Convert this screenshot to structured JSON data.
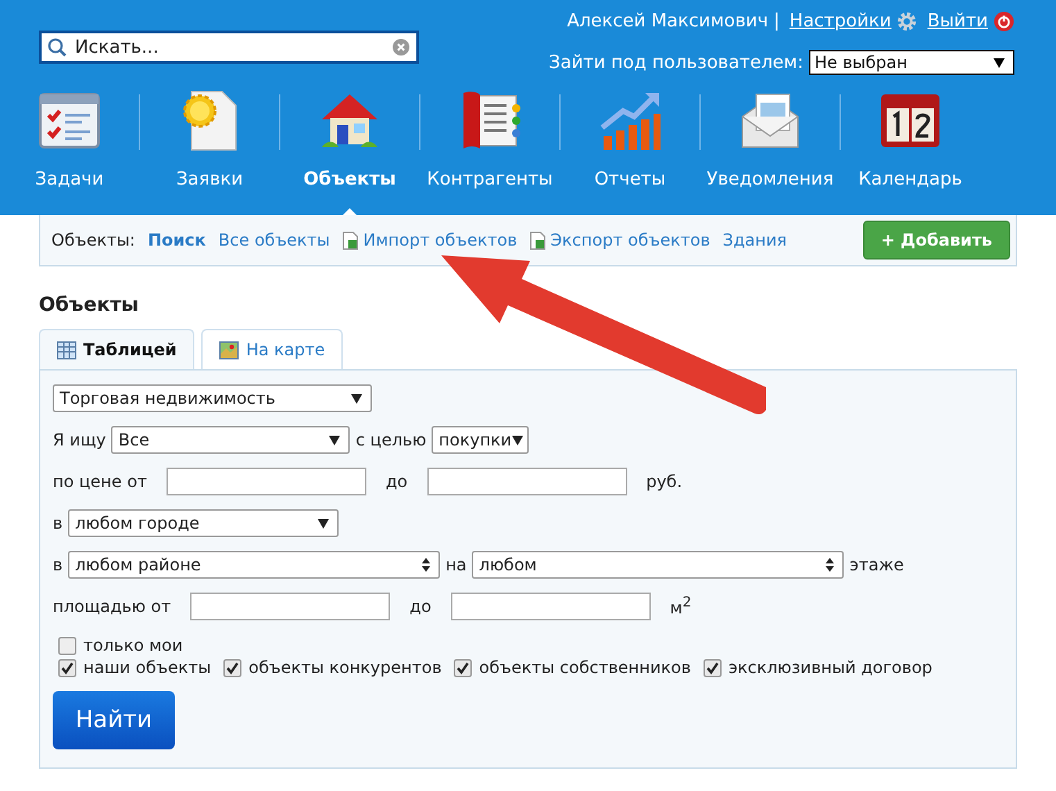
{
  "search": {
    "placeholder": "Искать..."
  },
  "user": {
    "name": "Алексей Максимович",
    "separator": "|",
    "settings": "Настройки",
    "logout": "Выйти"
  },
  "impersonate": {
    "label": "Зайти под пользователем:",
    "value": "Не выбран"
  },
  "nav": [
    {
      "label": "Задачи",
      "selected": false
    },
    {
      "label": "Заявки",
      "selected": false
    },
    {
      "label": "Объекты",
      "selected": true
    },
    {
      "label": "Контрагенты",
      "selected": false
    },
    {
      "label": "Отчеты",
      "selected": false
    },
    {
      "label": "Уведомления",
      "selected": false
    },
    {
      "label": "Календарь",
      "selected": false
    }
  ],
  "subnav": {
    "label": "Объекты:",
    "links": [
      {
        "label": "Поиск",
        "selected": true,
        "kind": "plain"
      },
      {
        "label": "Все объекты",
        "selected": false,
        "kind": "plain"
      },
      {
        "label": "Импорт объектов",
        "selected": false,
        "kind": "import"
      },
      {
        "label": "Экспорт объектов",
        "selected": false,
        "kind": "export"
      },
      {
        "label": "Здания",
        "selected": false,
        "kind": "plain"
      }
    ],
    "add_button": "+ Добавить"
  },
  "heading": "Объекты",
  "tabs": [
    {
      "label": "Таблицей",
      "selected": true,
      "kind": "table"
    },
    {
      "label": "На карте",
      "selected": false,
      "kind": "map"
    }
  ],
  "form": {
    "property_type": "Торговая недвижимость",
    "seek_label": "Я ищу",
    "seek": "Все",
    "purpose_label": "с целью",
    "purpose": "покупки",
    "price_label": "по цене от",
    "price_to": "до",
    "price_unit": "руб.",
    "city_prefix": "в",
    "city": "любом городе",
    "district_prefix": "в",
    "district": "любом районе",
    "floor_label": "на",
    "floor": "любом",
    "floor_suffix": "этаже",
    "area_label": "площадью от",
    "area_to": "до",
    "area_unit": "м$^{2}$",
    "checkbox_rows": [
      [
        {
          "label": "только мои",
          "checked": false
        }
      ],
      [
        {
          "label": "наши объекты",
          "checked": true
        },
        {
          "label": "объекты конкурентов",
          "checked": true
        },
        {
          "label": "объекты собственников",
          "checked": true
        },
        {
          "label": "эксклюзивный договор",
          "checked": true
        }
      ]
    ],
    "submit": "Найти"
  }
}
